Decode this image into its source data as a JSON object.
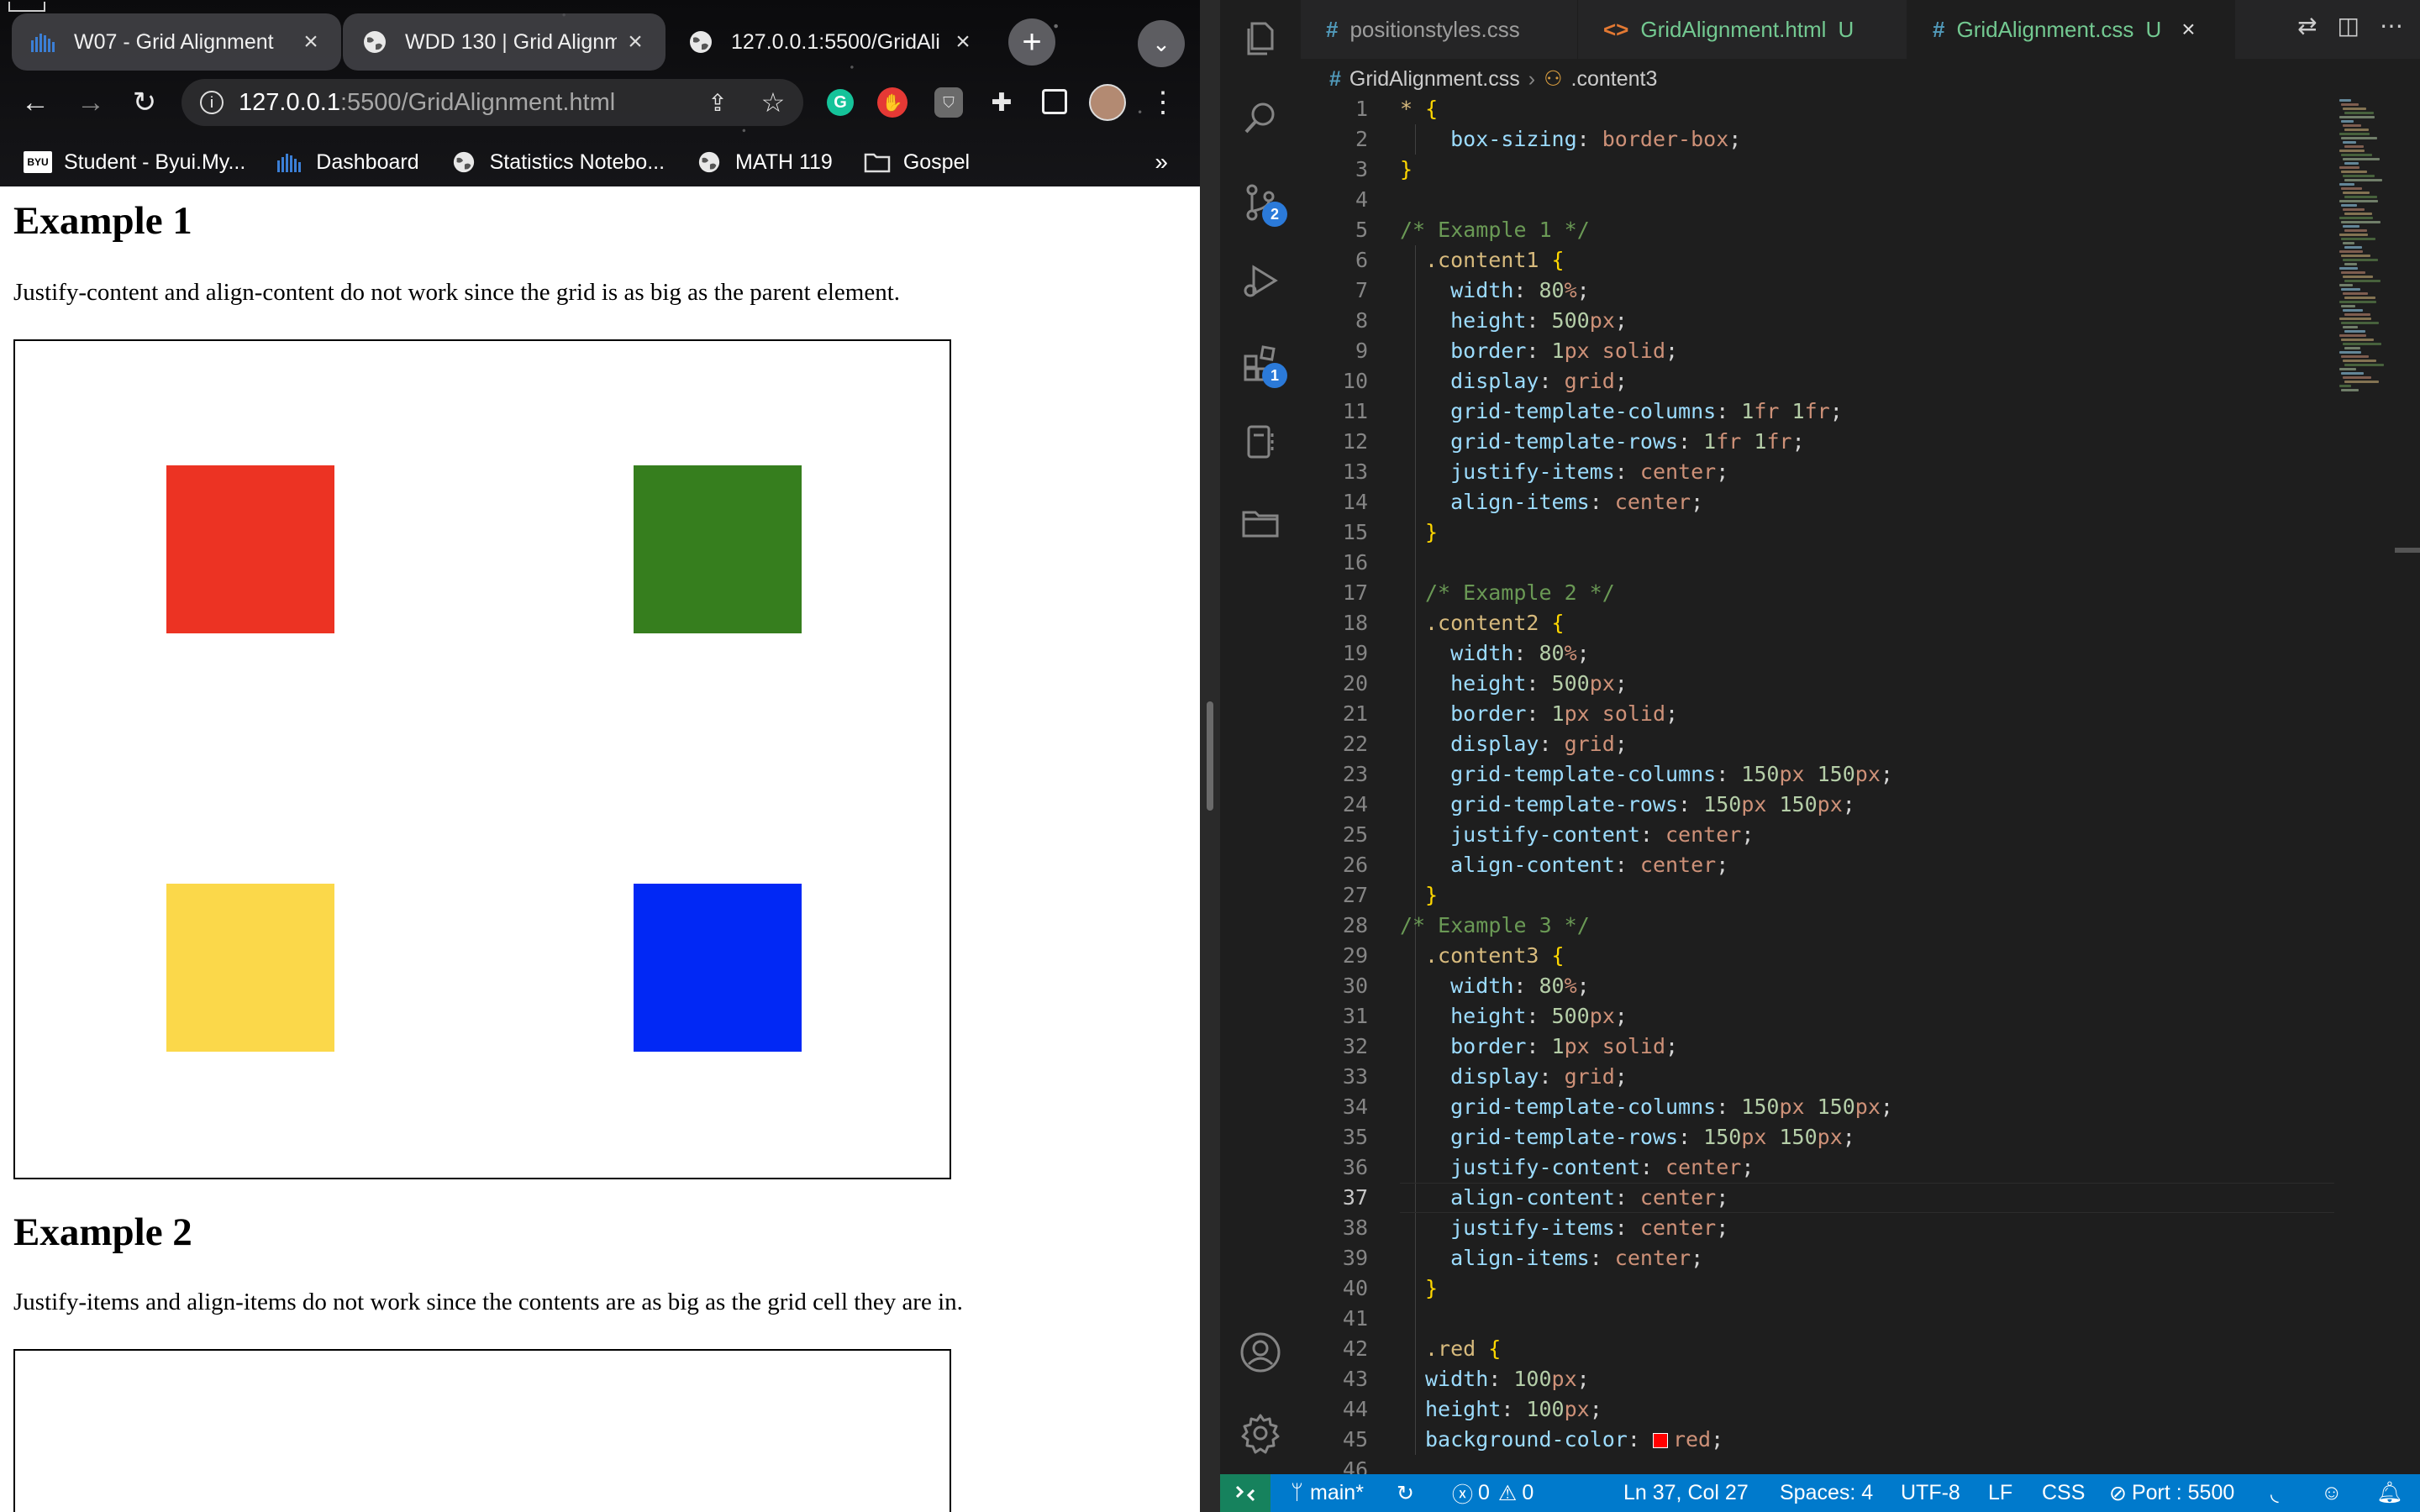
{
  "browser": {
    "tabs": [
      {
        "title": "W07 - Grid Alignment",
        "icon": "canvas-icon",
        "state": "inactive"
      },
      {
        "title": "WDD 130 | Grid Alignm",
        "icon": "globe-icon",
        "state": "inactive"
      },
      {
        "title": "127.0.0.1:5500/GridAli",
        "icon": "globe-icon",
        "state": "active"
      }
    ],
    "address": {
      "host": "127.0.0.1",
      "path": ":5500/GridAlignment.html"
    },
    "bookmarks": [
      {
        "label": "Student - Byui.My...",
        "icon": "byu-idaho-icon",
        "badge": "BYU"
      },
      {
        "label": "Dashboard",
        "icon": "canvas-icon"
      },
      {
        "label": "Statistics Notebo...",
        "icon": "globe-icon"
      },
      {
        "label": "MATH 119",
        "icon": "globe-icon"
      },
      {
        "label": "Gospel",
        "icon": "folder-icon"
      }
    ],
    "bookmarks_more": "»",
    "page": {
      "example1": {
        "heading": "Example 1",
        "text": "Justify-content and align-content do not work since the grid is as big as the parent element."
      },
      "example2": {
        "heading": "Example 2",
        "text": "Justify-items and align-items do not work since the contents are as big as the grid cell they are in."
      },
      "square_colors": {
        "red": "#ec3323",
        "green": "#367e1e",
        "yellow": "#fbd84a",
        "blue": "#0128f5"
      }
    }
  },
  "vscode": {
    "tabs": [
      {
        "label": "positionstyles.css",
        "kind": "css",
        "modified": "",
        "active": false
      },
      {
        "label": "GridAlignment.html",
        "kind": "html",
        "modified": "U",
        "active": false
      },
      {
        "label": "GridAlignment.css",
        "kind": "css",
        "modified": "U",
        "active": true
      }
    ],
    "breadcrumb": {
      "file": "GridAlignment.css",
      "symbol": ".content3"
    },
    "activity_badges": {
      "source_control": "2",
      "extensions": "1"
    },
    "current_line": 37,
    "code": [
      {
        "n": "1",
        "text": "* {"
      },
      {
        "n": "2",
        "text": "  box-sizing: border-box;"
      },
      {
        "n": "3",
        "text": "}"
      },
      {
        "n": "4",
        "text": ""
      },
      {
        "n": "5",
        "text": "/* Example 1 */"
      },
      {
        "n": "6",
        "text": ".content1 {"
      },
      {
        "n": "7",
        "text": "  width: 80%;"
      },
      {
        "n": "8",
        "text": "  height: 500px;"
      },
      {
        "n": "9",
        "text": "  border: 1px solid;"
      },
      {
        "n": "10",
        "text": "  display: grid;"
      },
      {
        "n": "11",
        "text": "  grid-template-columns: 1fr 1fr;"
      },
      {
        "n": "12",
        "text": "  grid-template-rows: 1fr 1fr;"
      },
      {
        "n": "13",
        "text": "  justify-items: center;"
      },
      {
        "n": "14",
        "text": "  align-items: center;"
      },
      {
        "n": "15",
        "text": "}"
      },
      {
        "n": "16",
        "text": ""
      },
      {
        "n": "17",
        "text": "/* Example 2 */"
      },
      {
        "n": "18",
        "text": ".content2 {"
      },
      {
        "n": "19",
        "text": "  width: 80%;"
      },
      {
        "n": "20",
        "text": "  height: 500px;"
      },
      {
        "n": "21",
        "text": "  border: 1px solid;"
      },
      {
        "n": "22",
        "text": "  display: grid;"
      },
      {
        "n": "23",
        "text": "  grid-template-columns: 150px 150px;"
      },
      {
        "n": "24",
        "text": "  grid-template-rows: 150px 150px;"
      },
      {
        "n": "25",
        "text": "  justify-content: center;"
      },
      {
        "n": "26",
        "text": "  align-content: center;"
      },
      {
        "n": "27",
        "text": "}"
      },
      {
        "n": "28",
        "text": "/* Example 3 */"
      },
      {
        "n": "29",
        "text": ".content3 {"
      },
      {
        "n": "30",
        "text": "  width: 80%;"
      },
      {
        "n": "31",
        "text": "  height: 500px;"
      },
      {
        "n": "32",
        "text": "  border: 1px solid;"
      },
      {
        "n": "33",
        "text": "  display: grid;"
      },
      {
        "n": "34",
        "text": "  grid-template-columns: 150px 150px;"
      },
      {
        "n": "35",
        "text": "  grid-template-rows: 150px 150px;"
      },
      {
        "n": "36",
        "text": "  justify-content: center;"
      },
      {
        "n": "37",
        "text": "  align-content: center;"
      },
      {
        "n": "38",
        "text": "  justify-items: center;"
      },
      {
        "n": "39",
        "text": "  align-items: center;"
      },
      {
        "n": "40",
        "text": "}"
      },
      {
        "n": "41",
        "text": ""
      },
      {
        "n": "42",
        "text": ".red {"
      },
      {
        "n": "43",
        "text": "width: 100px;"
      },
      {
        "n": "44",
        "text": "height: 100px;"
      },
      {
        "n": "45",
        "text": "background-color: red;"
      },
      {
        "n": "46",
        "text": ""
      }
    ],
    "status": {
      "branch": "main*",
      "errors": "0",
      "warnings": "0",
      "cursor": "Ln 37, Col 27",
      "spaces": "Spaces: 4",
      "encoding": "UTF-8",
      "eol": "LF",
      "language": "CSS",
      "port": "Port : 5500"
    }
  }
}
